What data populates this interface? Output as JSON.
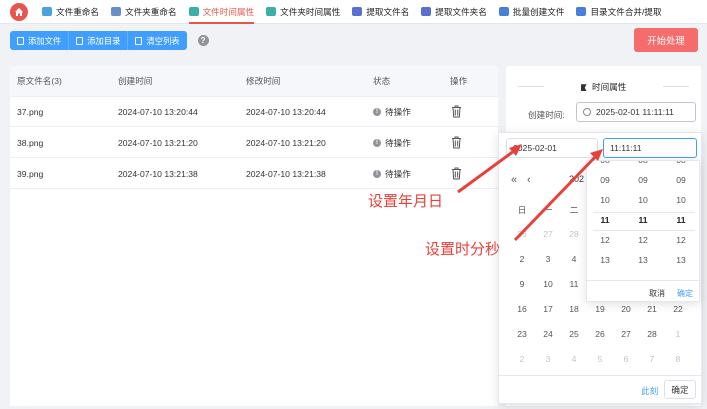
{
  "nav": {
    "tabs": [
      {
        "label": "文件重命名",
        "color": "#4aa3df"
      },
      {
        "label": "文件夹重命名",
        "color": "#6a8fc7"
      },
      {
        "label": "文件时间属性",
        "color": "#3ab0a8"
      },
      {
        "label": "文件夹时间属性",
        "color": "#3ab0a8"
      },
      {
        "label": "提取文件名",
        "color": "#5a6fd0"
      },
      {
        "label": "提取文件夹名",
        "color": "#5a6fd0"
      },
      {
        "label": "批量创建文件",
        "color": "#4a7fd8"
      },
      {
        "label": "目录文件合并/提取",
        "color": "#4a7fd8"
      }
    ],
    "active_index": 2
  },
  "toolbar": {
    "add_file": "添加文件",
    "add_dir": "添加目录",
    "clear_list": "清空列表",
    "help": "?",
    "start": "开始处理"
  },
  "table": {
    "headers": [
      "原文件名(3)",
      "创建时间",
      "修改时间",
      "状态",
      "操作"
    ],
    "rows": [
      {
        "name": "37.png",
        "created": "2024-07-10 13:20:44",
        "modified": "2024-07-10 13:20:44",
        "status": "待操作"
      },
      {
        "name": "38.png",
        "created": "2024-07-10 13:21:20",
        "modified": "2024-07-10 13:21:20",
        "status": "待操作"
      },
      {
        "name": "39.png",
        "created": "2024-07-10 13:21:38",
        "modified": "2024-07-10 13:21:38",
        "status": "待操作"
      }
    ]
  },
  "props": {
    "title": "时间属性",
    "created_label": "创建时间:",
    "created_value": "2025-02-01 11:11:11"
  },
  "datepicker": {
    "date_value": "2025-02-01",
    "time_value": "11:11:11",
    "year_month": "202",
    "weekdays": [
      "日",
      "一",
      "二"
    ],
    "rows": [
      [
        "26",
        "27",
        "28"
      ],
      [
        "2",
        "3",
        "4"
      ],
      [
        "9",
        "10",
        "11"
      ],
      [
        "16",
        "17",
        "18",
        "19",
        "20",
        "21",
        "22"
      ],
      [
        "23",
        "24",
        "25",
        "26",
        "27",
        "28",
        "1"
      ],
      [
        "2",
        "3",
        "4",
        "5",
        "6",
        "7",
        "8"
      ]
    ],
    "now_label": "此刻",
    "ok_label": "确定"
  },
  "timepicker": {
    "hours": [
      "08",
      "09",
      "10",
      "11",
      "12",
      "13"
    ],
    "minutes": [
      "08",
      "09",
      "10",
      "11",
      "12",
      "13"
    ],
    "seconds": [
      "08",
      "09",
      "10",
      "11",
      "12",
      "13"
    ],
    "cancel_label": "取消",
    "ok_label": "确定"
  },
  "annotations": {
    "date_hint": "设置年月日",
    "time_hint": "设置时分秒",
    "color": "#e8413a"
  },
  "colors": {
    "accent": "#409eff",
    "brand_red": "#e8554e",
    "start_button": "#f56c6c"
  }
}
